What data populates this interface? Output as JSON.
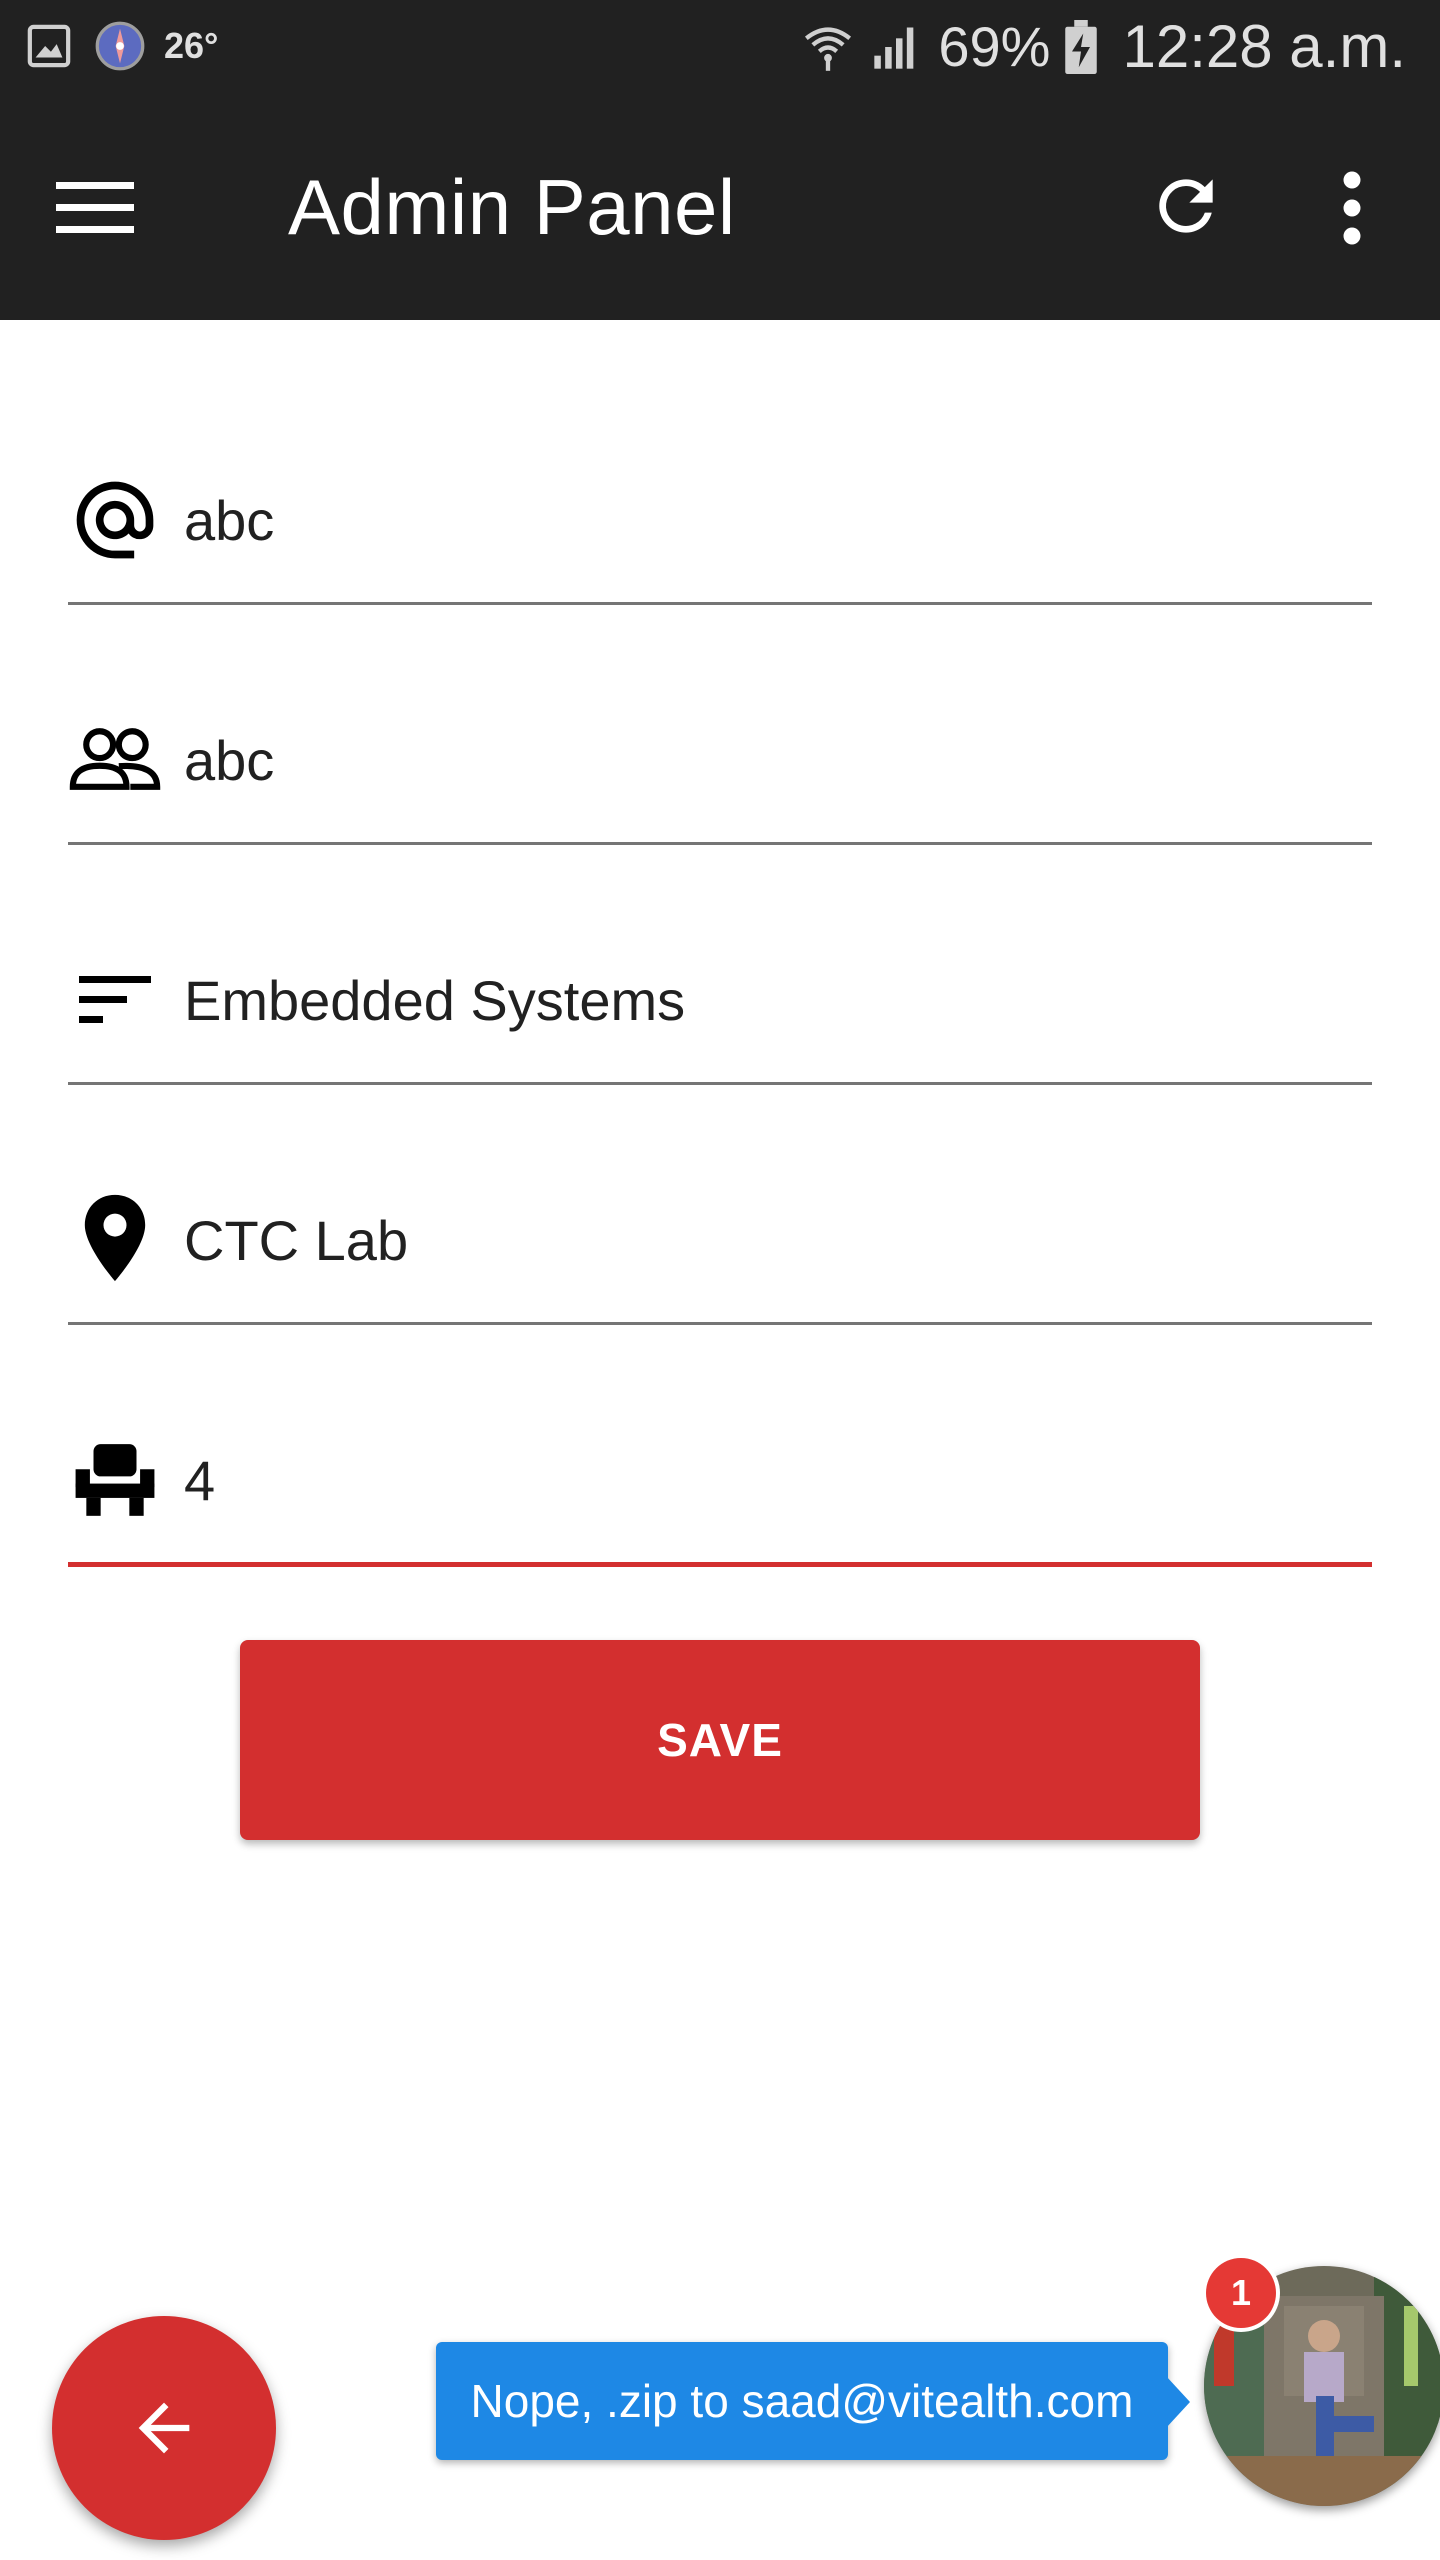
{
  "status_bar": {
    "temperature": "26°",
    "battery": "69%",
    "time": "12:28 a.m.",
    "icons": [
      "gallery-icon",
      "compass-icon",
      "wifi-icon",
      "signal-icon",
      "battery-charging-icon"
    ]
  },
  "app_bar": {
    "title": "Admin Panel",
    "icons": [
      "menu-icon",
      "refresh-icon",
      "more-vert-icon"
    ]
  },
  "form": {
    "fields": [
      {
        "icon": "at-icon",
        "value": "abc"
      },
      {
        "icon": "group-icon",
        "value": "abc"
      },
      {
        "icon": "sort-icon",
        "value": "Embedded Systems"
      },
      {
        "icon": "location-pin-icon",
        "value": "CTC Lab"
      },
      {
        "icon": "seat-icon",
        "value": "4",
        "active": true
      }
    ],
    "save_label": "SAVE"
  },
  "fab": {
    "icon": "arrow-back-icon"
  },
  "chat_head": {
    "message": "Nope, .zip to saad@vitealth.com",
    "badge_count": "1"
  },
  "colors": {
    "app_bar": "#212121",
    "accent": "#d32f2f",
    "chat_bubble": "#1e88e5",
    "underline": "#757575"
  }
}
